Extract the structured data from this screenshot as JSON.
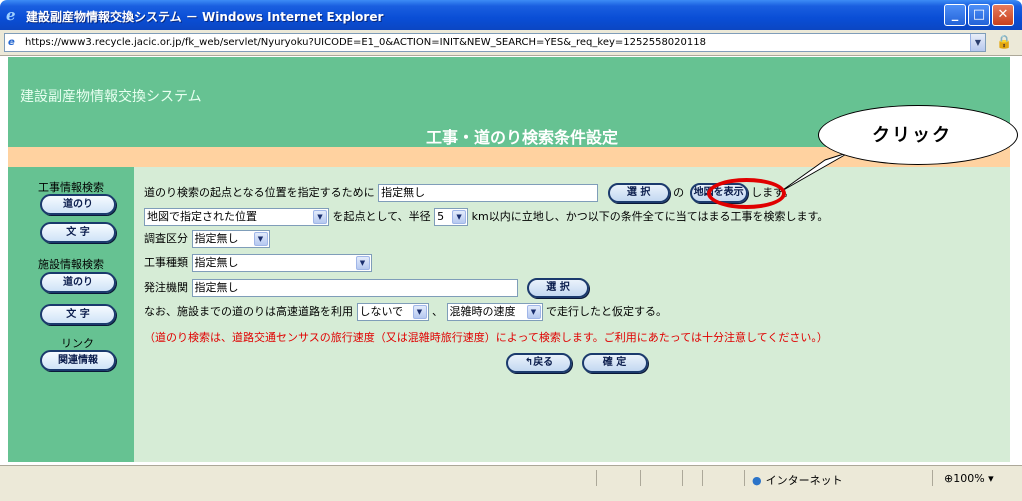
{
  "window": {
    "title": "建設副産物情報交換システム － Windows Internet Explorer",
    "url": "https://www3.recycle.jacic.or.jp/fk_web/servlet/Nyuryoku?UICODE=E1_0&ACTION=INIT&NEW_SEARCH=YES&_req_key=1252558020118"
  },
  "header": {
    "system_name": "建設副産物情報交換システム",
    "page_title": "工事・道のり検索条件設定"
  },
  "sidebar": {
    "section_construction": "工事情報検索",
    "section_facility": "施設情報検索",
    "section_link": "リンク",
    "btn_route": "道のり",
    "btn_text": "文 字",
    "btn_route2": "道のり",
    "btn_text2": "文 字",
    "btn_related": "関連情報"
  },
  "form": {
    "line1_prefix": "道のり検索の起点となる位置を指定するために",
    "origin_value": "指定無し",
    "select_button": "選 択",
    "line1_no": "の",
    "map_button": "地図を表示",
    "line1_suffix": "します。",
    "origin_mode": "地図で指定された位置",
    "line2_middle": "を起点として、半径",
    "radius": "5",
    "line2_suffix": "km以内に立地し、かつ以下の条件全てに当てはまる工事を検索します。",
    "survey_label": "調査区分",
    "survey_value": "指定無し",
    "work_type_label": "工事種類",
    "work_type_value": "指定無し",
    "agency_label": "発注機関",
    "agency_value": "指定無し",
    "agency_select_button": "選 択",
    "line6_prefix": "なお、施設までの道のりは高速道路を利用",
    "highway_value": "しないで",
    "line6_comma": "、",
    "speed_value": "混雑時の速度",
    "line6_suffix": "で走行したと仮定する。",
    "notice": "（道のり検索は、道路交通センサスの旅行速度（又は混雑時旅行速度）によって検索します。ご利用にあたっては十分注意してください。）",
    "back_button": "戻る",
    "confirm_button": "確 定"
  },
  "callout": {
    "text": "クリック"
  },
  "status": {
    "zone": "インターネット",
    "zoom": "100%"
  }
}
